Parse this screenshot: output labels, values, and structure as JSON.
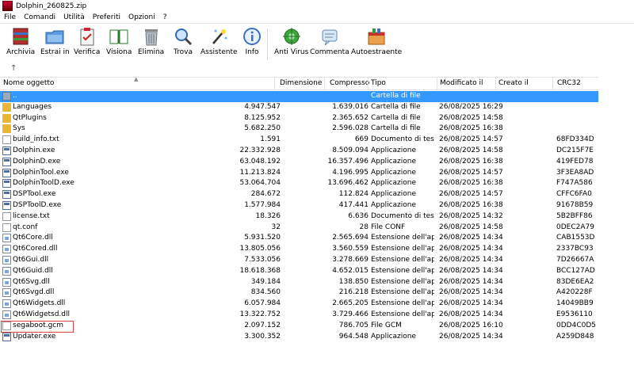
{
  "window": {
    "title": "Dolphin_260825.zip"
  },
  "menu": [
    "File",
    "Comandi",
    "Utilità",
    "Preferiti",
    "Opzioni",
    "?"
  ],
  "toolbar": [
    {
      "label": "Archivia",
      "icon": "archive-icon"
    },
    {
      "label": "Estrai in",
      "icon": "extract-folder-icon"
    },
    {
      "label": "Verifica",
      "icon": "verify-clipboard-icon"
    },
    {
      "label": "Visiona",
      "icon": "view-book-icon"
    },
    {
      "label": "Elimina",
      "icon": "trash-icon"
    },
    {
      "label": "Trova",
      "icon": "magnifier-icon"
    },
    {
      "label": "Assistente",
      "icon": "wizard-wand-icon"
    },
    {
      "label": "Info",
      "icon": "info-icon"
    },
    {
      "label": "Anti Virus",
      "icon": "antivirus-icon"
    },
    {
      "label": "Commenta",
      "icon": "comment-icon"
    },
    {
      "label": "Autoestraente",
      "icon": "sfx-box-icon"
    }
  ],
  "columns": [
    "Nome oggetto",
    "Dimensione",
    "Compresso",
    "Tipo",
    "Modificato il",
    "Creato il",
    "CRC32"
  ],
  "rows": [
    {
      "name": "..",
      "size": "",
      "comp": "",
      "type": "Cartella di file",
      "mod": "",
      "crc": "",
      "kind": "up"
    },
    {
      "name": "Languages",
      "size": "4.947.547",
      "comp": "1.639.016",
      "type": "Cartella di file",
      "mod": "26/08/2025 16:29",
      "crc": "",
      "kind": "folder"
    },
    {
      "name": "QtPlugins",
      "size": "8.125.952",
      "comp": "2.365.652",
      "type": "Cartella di file",
      "mod": "26/08/2025 14:58",
      "crc": "",
      "kind": "folder"
    },
    {
      "name": "Sys",
      "size": "5.682.250",
      "comp": "2.596.028",
      "type": "Cartella di file",
      "mod": "26/08/2025 16:38",
      "crc": "",
      "kind": "folder"
    },
    {
      "name": "build_info.txt",
      "size": "1.591",
      "comp": "669",
      "type": "Documento di testo",
      "mod": "26/08/2025 14:57",
      "crc": "68FD334D",
      "kind": "txt"
    },
    {
      "name": "Dolphin.exe",
      "size": "22.332.928",
      "comp": "8.509.094",
      "type": "Applicazione",
      "mod": "26/08/2025 14:58",
      "crc": "DC215F7E",
      "kind": "exe"
    },
    {
      "name": "DolphinD.exe",
      "size": "63.048.192",
      "comp": "16.357.496",
      "type": "Applicazione",
      "mod": "26/08/2025 16:38",
      "crc": "419FED78",
      "kind": "exe"
    },
    {
      "name": "DolphinTool.exe",
      "size": "11.213.824",
      "comp": "4.196.995",
      "type": "Applicazione",
      "mod": "26/08/2025 14:57",
      "crc": "3F3EA8AD",
      "kind": "exe"
    },
    {
      "name": "DolphinToolD.exe",
      "size": "53.064.704",
      "comp": "13.696.462",
      "type": "Applicazione",
      "mod": "26/08/2025 16:38",
      "crc": "F747A586",
      "kind": "exe"
    },
    {
      "name": "DSPTool.exe",
      "size": "284.672",
      "comp": "112.824",
      "type": "Applicazione",
      "mod": "26/08/2025 14:57",
      "crc": "CFFC6FA0",
      "kind": "exe"
    },
    {
      "name": "DSPToolD.exe",
      "size": "1.577.984",
      "comp": "417.441",
      "type": "Applicazione",
      "mod": "26/08/2025 16:38",
      "crc": "91678B59",
      "kind": "exe"
    },
    {
      "name": "license.txt",
      "size": "18.326",
      "comp": "6.636",
      "type": "Documento di testo",
      "mod": "26/08/2025 14:32",
      "crc": "5B2BFF86",
      "kind": "txt"
    },
    {
      "name": "qt.conf",
      "size": "32",
      "comp": "28",
      "type": "File CONF",
      "mod": "26/08/2025 14:58",
      "crc": "0DEC2A79",
      "kind": "txt"
    },
    {
      "name": "Qt6Core.dll",
      "size": "5.931.520",
      "comp": "2.565.694",
      "type": "Estensione dell'ap...",
      "mod": "26/08/2025 14:34",
      "crc": "CAB1553D",
      "kind": "dll"
    },
    {
      "name": "Qt6Cored.dll",
      "size": "13.805.056",
      "comp": "3.560.559",
      "type": "Estensione dell'ap...",
      "mod": "26/08/2025 14:34",
      "crc": "2337BC93",
      "kind": "dll"
    },
    {
      "name": "Qt6Gui.dll",
      "size": "7.533.056",
      "comp": "3.278.669",
      "type": "Estensione dell'ap...",
      "mod": "26/08/2025 14:34",
      "crc": "7D26667A",
      "kind": "dll"
    },
    {
      "name": "Qt6Guid.dll",
      "size": "18.618.368",
      "comp": "4.652.015",
      "type": "Estensione dell'ap...",
      "mod": "26/08/2025 14:34",
      "crc": "BCC127AD",
      "kind": "dll"
    },
    {
      "name": "Qt6Svg.dll",
      "size": "349.184",
      "comp": "138.850",
      "type": "Estensione dell'ap...",
      "mod": "26/08/2025 14:34",
      "crc": "83DE6EA2",
      "kind": "dll"
    },
    {
      "name": "Qt6Svgd.dll",
      "size": "834.560",
      "comp": "216.218",
      "type": "Estensione dell'ap...",
      "mod": "26/08/2025 14:34",
      "crc": "A420228F",
      "kind": "dll"
    },
    {
      "name": "Qt6Widgets.dll",
      "size": "6.057.984",
      "comp": "2.665.205",
      "type": "Estensione dell'ap...",
      "mod": "26/08/2025 14:34",
      "crc": "14049BB9",
      "kind": "dll"
    },
    {
      "name": "Qt6Widgetsd.dll",
      "size": "13.322.752",
      "comp": "3.729.466",
      "type": "Estensione dell'ap...",
      "mod": "26/08/2025 14:34",
      "crc": "E9536110",
      "kind": "dll"
    },
    {
      "name": "segaboot.gcm",
      "size": "2.097.152",
      "comp": "786.705",
      "type": "File GCM",
      "mod": "26/08/2025 16:10",
      "crc": "0DD4C0D5",
      "kind": "txt"
    },
    {
      "name": "Updater.exe",
      "size": "3.300.352",
      "comp": "964.548",
      "type": "Applicazione",
      "mod": "26/08/2025 14:34",
      "crc": "A259D848",
      "kind": "exe"
    }
  ],
  "colors": {
    "selection": "#3399ff",
    "highlight_box": "#e04040",
    "folder": "#e8b632"
  }
}
